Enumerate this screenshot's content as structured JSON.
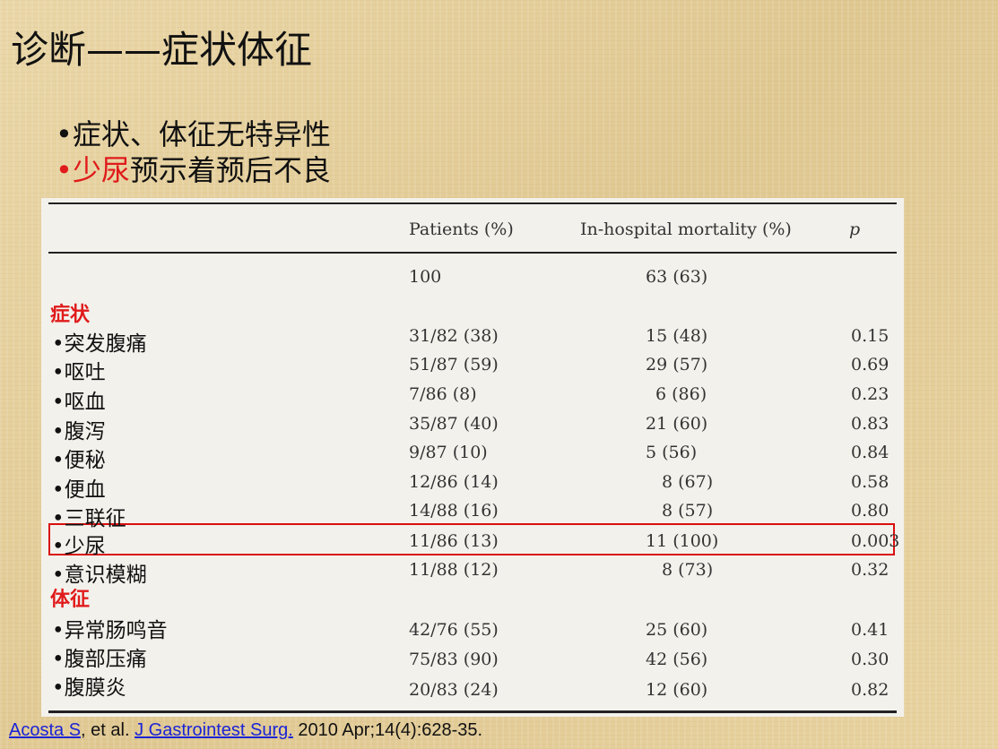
{
  "title": "诊断——症状体征",
  "bullets": {
    "b1": "•症状、体征无特异性",
    "b2_red": "•少尿",
    "b2_rest": "预示着预后不良"
  },
  "table": {
    "headers": {
      "patients": "Patients (%)",
      "mortality": "In-hospital mortality (%)",
      "p": "p"
    },
    "total": {
      "patients": "100",
      "mortality": "63 (63)"
    },
    "sections": {
      "symptoms": "症状",
      "signs": "体征"
    },
    "rows": [
      {
        "label": "•突发腹痛",
        "patients": "31/82 (38)",
        "mortality": "15 (48)",
        "p": "0.15"
      },
      {
        "label": "•呕吐",
        "patients": "51/87 (59)",
        "mortality": "29 (57)",
        "p": "0.69"
      },
      {
        "label": "•呕血",
        "patients": "7/86 (8)",
        "mortality": "6 (86)",
        "p": "0.23"
      },
      {
        "label": "•腹泻",
        "patients": "35/87 (40)",
        "mortality": "21 (60)",
        "p": "0.83"
      },
      {
        "label": "•便秘",
        "patients": "9/87 (10)",
        "mortality": "5 (56)",
        "p": "0.84"
      },
      {
        "label": "•便血",
        "patients": "12/86 (14)",
        "mortality": "8 (67)",
        "p": "0.58"
      },
      {
        "label": "•三联征",
        "patients": "14/88 (16)",
        "mortality": "8 (57)",
        "p": "0.80"
      },
      {
        "label": "•少尿",
        "patients": "11/86 (13)",
        "mortality": "11 (100)",
        "p": "0.003"
      },
      {
        "label": "•意识模糊",
        "patients": "11/88 (12)",
        "mortality": "8 (73)",
        "p": "0.32"
      },
      {
        "label": "•异常肠鸣音",
        "patients": "42/76 (55)",
        "mortality": "25 (60)",
        "p": "0.41"
      },
      {
        "label": "•腹部压痛",
        "patients": "75/83 (90)",
        "mortality": "42 (56)",
        "p": "0.30"
      },
      {
        "label": "•腹膜炎",
        "patients": "20/83 (24)",
        "mortality": "12 (60)",
        "p": "0.82"
      }
    ]
  },
  "citation": {
    "author": "Acosta S",
    "etal": ", et al. ",
    "journal": "J Gastrointest Surg.",
    "rest": " 2010 Apr;14(4):628-35."
  }
}
